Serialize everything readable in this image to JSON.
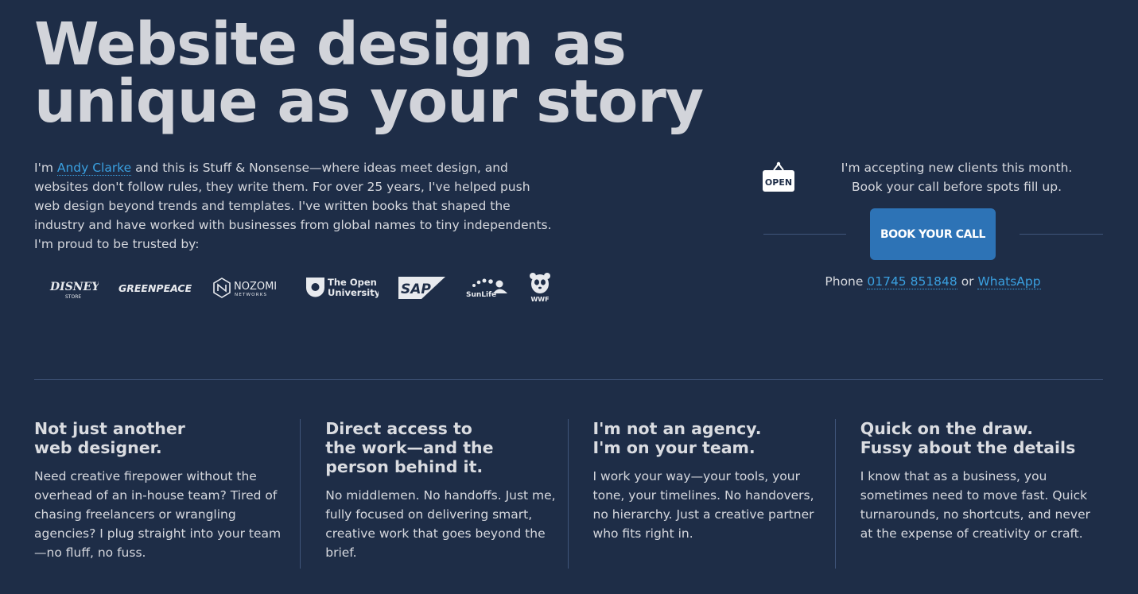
{
  "hero": {
    "headline_line1": "Website design as",
    "headline_line2": "unique as your story"
  },
  "intro": {
    "prefix": "I'm ",
    "name_link": "Andy Clarke",
    "body": " and this is Stuff & Nonsense—where ideas meet design, and websites don't follow rules, they write them. For over 25 years, I've helped push web design beyond trends and templates. I've written books that shaped the industry and have worked with businesses from global names to tiny independents. I'm proud to be trusted by:"
  },
  "logos": {
    "disney_main": "DISNEY",
    "disney_sub": "STORE",
    "greenpeace": "GREENPEACE",
    "nozomi_main": "NOZOMI",
    "nozomi_sub": "NETWORKS",
    "ou_line1": "The Open",
    "ou_line2": "University",
    "sap": "SAP",
    "sunlife": "SunLife",
    "wwf": "WWF"
  },
  "cta": {
    "sign_text": "OPEN",
    "line1": "I'm accepting new clients this month.",
    "line2": "Book your call before spots fill up.",
    "button_label": "Book your call",
    "phone_prefix": "Phone ",
    "phone_number": "01745 851848",
    "or_text": " or ",
    "whatsapp": "WhatsApp"
  },
  "features": [
    {
      "title_line1": "Not just another",
      "title_line2": "web designer.",
      "title_line3": "",
      "body": "Need creative firepower without the overhead of an in-house team? Tired of chasing freelancers or wrangling agencies? I plug straight into your team—no fluff, no fuss."
    },
    {
      "title_line1": "Direct access to",
      "title_line2": "the work—and the",
      "title_line3": "person behind it.",
      "body": "No middlemen. No handoffs. Just me, fully focused on delivering smart, creative work that goes beyond the brief."
    },
    {
      "title_line1": "I'm not an agency.",
      "title_line2": "I'm on your team.",
      "title_line3": "",
      "body": "I work your way—your tools, your tone, your timelines. No handovers, no hierarchy. Just a creative partner who fits right in."
    },
    {
      "title_line1": "Quick on the draw.",
      "title_line2": "Fussy about the details",
      "title_line3": "",
      "body": "I know that as a business, you sometimes need to move fast. Quick turnarounds, no shortcuts, and never at the expense of creativity or craft."
    }
  ],
  "colors": {
    "background": "#1e2d47",
    "link": "#3aa0e0",
    "button": "#2d73b6",
    "rule": "#40557a",
    "text": "#d2d4da"
  }
}
